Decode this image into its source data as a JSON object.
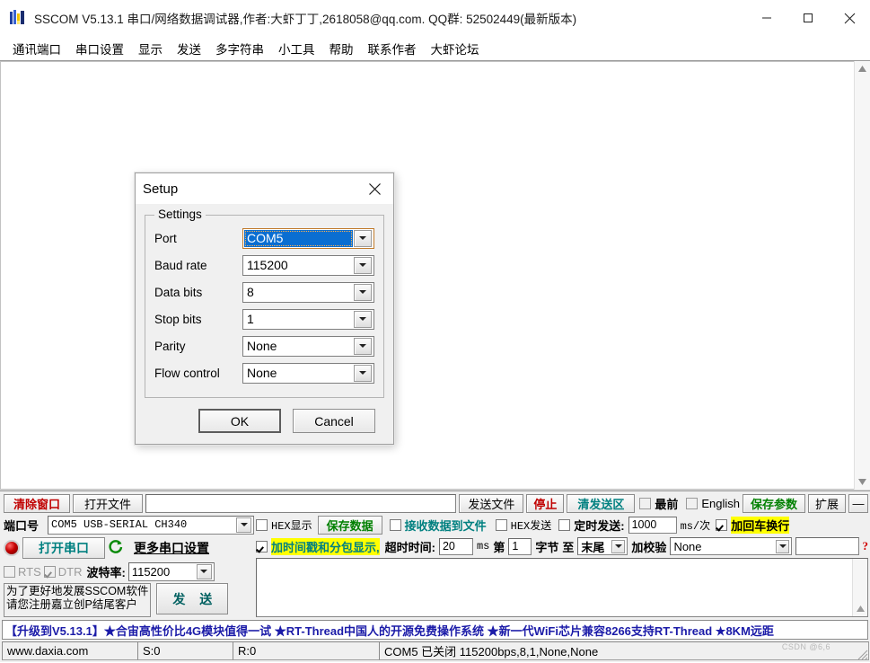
{
  "titlebar": {
    "title": "SSCOM V5.13.1 串口/网络数据调试器,作者:大虾丁丁,2618058@qq.com. QQ群: 52502449(最新版本)",
    "minimize": "—",
    "maximize": "☐",
    "close": "✕",
    "icon": "app-icon"
  },
  "menu": {
    "items": [
      {
        "label": "通讯端口"
      },
      {
        "label": "串口设置"
      },
      {
        "label": "显示"
      },
      {
        "label": "发送"
      },
      {
        "label": "多字符串"
      },
      {
        "label": "小工具"
      },
      {
        "label": "帮助"
      },
      {
        "label": "联系作者"
      },
      {
        "label": "大虾论坛"
      }
    ]
  },
  "receive": {
    "text": ""
  },
  "toolbar_top": {
    "clear_window": "清除窗口",
    "open_file": "打开文件",
    "file_path_value": "",
    "send_file": "发送文件",
    "stop": "停止",
    "clear_send": "清发送区",
    "topmost_label": "最前",
    "topmost_checked": false,
    "english_label": "English",
    "english_checked": false,
    "save_params": "保存参数",
    "extend": "扩展",
    "minus": "—"
  },
  "left_panel": {
    "port_label": "端口号",
    "port_value": "COM5 USB-SERIAL CH340",
    "open_port_button": "打开串口",
    "refresh_icon": "refresh-icon",
    "more_settings": "更多串口设置",
    "rts_label": "RTS",
    "rts_checked": false,
    "dtr_label": "DTR",
    "dtr_checked": true,
    "baud_label": "波特率:",
    "baud_value": "115200",
    "promo_line1": "为了更好地发展SSCOM软件",
    "promo_line2": "请您注册嘉立创P结尾客户",
    "send_button": "发 送"
  },
  "right_panel": {
    "hex_display_label": "HEX显示",
    "hex_display_checked": false,
    "save_data": "保存数据",
    "recv_to_file_label": "接收数据到文件",
    "recv_to_file_checked": false,
    "hex_send_label": "HEX发送",
    "hex_send_checked": false,
    "timed_send_label": "定时发送:",
    "timed_send_checked": false,
    "timed_send_value": "1000",
    "ms_per_unit": "ms/次",
    "crlf_label": "加回车换行",
    "crlf_checked": true,
    "timestamp_label": "加时间戳和分包显示,",
    "timestamp_checked": true,
    "timeout_label": "超时时间:",
    "timeout_value": "20",
    "ms": "ms",
    "byte_from": "第",
    "byte_index_value": "1",
    "byte_label": "字节",
    "to_label": "至",
    "to_value": "末尾",
    "checksum_label": "加校验",
    "checksum_value": "None",
    "checksum_extra_value": "",
    "help_mark": "?",
    "send_area_text": ""
  },
  "marquee": {
    "text": "【升级到V5.13.1】★合宙高性价比4G模块值得一试 ★RT-Thread中国人的开源免费操作系统 ★新一代WiFi芯片兼容8266支持RT-Thread ★8KM远距"
  },
  "statusbar": {
    "site": "www.daxia.com",
    "sent": "S:0",
    "received": "R:0",
    "port_status": "COM5 已关闭  115200bps,8,1,None,None",
    "watermark": "CSDN @6,6"
  },
  "dialog": {
    "title": "Setup",
    "close_icon": "close-icon",
    "group_legend": "Settings",
    "fields": [
      {
        "label": "Port",
        "value": "COM5",
        "selected": true
      },
      {
        "label": "Baud rate",
        "value": "115200",
        "selected": false
      },
      {
        "label": "Data bits",
        "value": "8",
        "selected": false
      },
      {
        "label": "Stop bits",
        "value": "1",
        "selected": false
      },
      {
        "label": "Parity",
        "value": "None",
        "selected": false
      },
      {
        "label": "Flow control",
        "value": "None",
        "selected": false
      }
    ],
    "ok": "OK",
    "cancel": "Cancel"
  },
  "colors": {
    "accent_blue": "#0a6ed1",
    "highlight_yellow": "#ffff00",
    "red": "#c00000",
    "teal": "#008080",
    "green": "#008000",
    "marquee_blue": "#1b1ba8"
  }
}
